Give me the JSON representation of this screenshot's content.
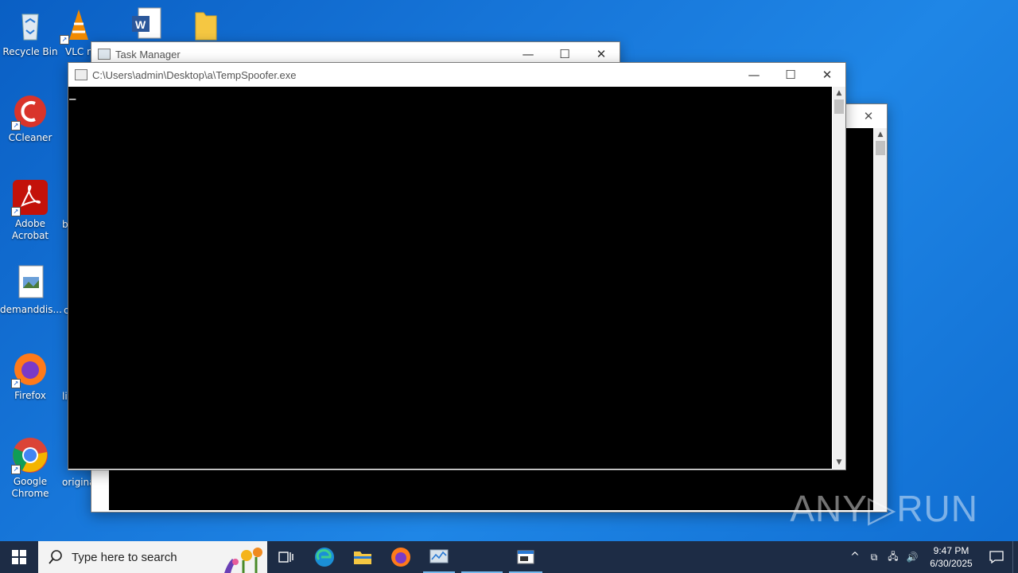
{
  "desktop": {
    "icons": [
      {
        "label": "Recycle Bin"
      },
      {
        "label": "VLC m"
      },
      {
        "label": "CCleaner"
      },
      {
        "label": "Adobe Acrobat"
      },
      {
        "label": "demanddis..."
      },
      {
        "label": "Firefox"
      },
      {
        "label": "Google Chrome"
      }
    ],
    "clipped_labels": [
      "b",
      "c",
      "lis",
      "origina"
    ]
  },
  "windows": {
    "task_manager": {
      "title": "Task Manager"
    },
    "console": {
      "title": "C:\\Users\\admin\\Desktop\\a\\TempSpoofer.exe",
      "cursor": "_"
    }
  },
  "window_controls": {
    "minimize": "—",
    "maximize": "☐",
    "close": "✕"
  },
  "taskbar": {
    "search_placeholder": "Type here to search",
    "time": "9:47 PM",
    "date": "6/30/2025",
    "tray_up": "^"
  },
  "watermark": "ANY▷RUN"
}
